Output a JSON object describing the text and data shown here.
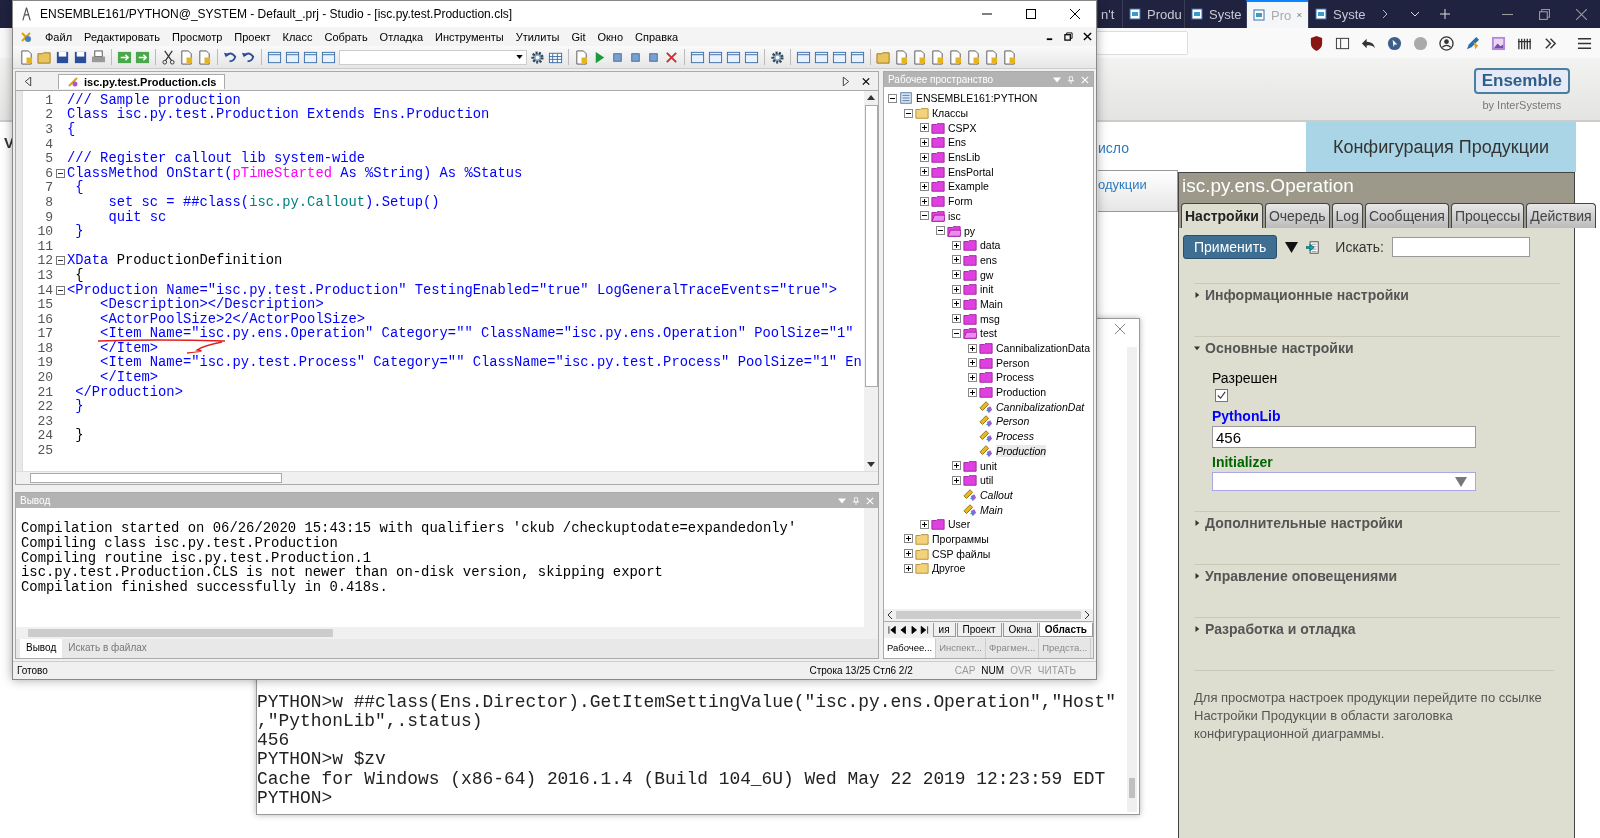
{
  "studio": {
    "title": "ENSEMBLE161/PYTHON@_SYSTEM - Default_.prj - Studio - [isc.py.test.Production.cls]",
    "menu": [
      "Файл",
      "Редактировать",
      "Просмотр",
      "Проект",
      "Класс",
      "Собрать",
      "Отладка",
      "Инструменты",
      "Утилиты",
      "Git",
      "Окно",
      "Справка"
    ],
    "editor_tab": "isc.py.test.Production.cls",
    "code": [
      {
        "number": "1",
        "fold": false,
        "tokens": [
          {
            "text": "/// Sample production",
            "kind": "kw"
          }
        ]
      },
      {
        "number": "2",
        "fold": false,
        "tokens": [
          {
            "text": "Class isc.py.test.Production Extends Ens.Production",
            "kind": "kw"
          }
        ]
      },
      {
        "number": "3",
        "fold": false,
        "tokens": [
          {
            "text": "{",
            "kind": "kw"
          }
        ]
      },
      {
        "number": "4",
        "fold": false
      },
      {
        "number": "5",
        "fold": false,
        "tokens": [
          {
            "text": "/// Register callout lib system-wide",
            "kind": "kw"
          }
        ]
      },
      {
        "number": "6",
        "fold": true,
        "tokens": [
          {
            "text": "ClassMethod OnStart(",
            "kind": "kw"
          },
          {
            "text": "pTimeStarted",
            "kind": "param"
          },
          {
            "text": " As %String) As %Status",
            "kind": "kw"
          }
        ]
      },
      {
        "number": "7",
        "fold": false,
        "tokens": [
          {
            "text": " {",
            "kind": "kw"
          }
        ]
      },
      {
        "number": "8",
        "fold": false,
        "tokens": [
          {
            "text": "     set sc = ##class(",
            "kind": "kw"
          },
          {
            "text": "isc.py.Callout",
            "kind": "cls"
          },
          {
            "text": ").Setup()",
            "kind": "kw"
          }
        ]
      },
      {
        "number": "9",
        "fold": false,
        "tokens": [
          {
            "text": "     quit sc",
            "kind": "kw"
          }
        ]
      },
      {
        "number": "10",
        "fold": false,
        "tokens": [
          {
            "text": " }",
            "kind": "kw"
          }
        ]
      },
      {
        "number": "11",
        "fold": false
      },
      {
        "number": "12",
        "fold": true,
        "tokens": [
          {
            "text": "XData",
            "kind": "kw"
          },
          {
            "text": " ProductionDefinition",
            "kind": "plain"
          }
        ]
      },
      {
        "number": "13",
        "fold": false,
        "tokens": [
          {
            "text": " {",
            "kind": "plain"
          }
        ]
      },
      {
        "number": "14",
        "fold": true,
        "tokens": [
          {
            "text": "<Production Name=\"isc.py.test.Production\" TestingEnabled=\"true\" LogGeneralTraceEvents=\"true\">",
            "kind": "kw"
          }
        ]
      },
      {
        "number": "15",
        "fold": false,
        "tokens": [
          {
            "text": "    <Description></Description>",
            "kind": "kw"
          }
        ]
      },
      {
        "number": "16",
        "fold": false,
        "tokens": [
          {
            "text": "    <ActorPoolSize>2</ActorPoolSize>",
            "kind": "kw"
          }
        ]
      },
      {
        "number": "17",
        "fold": false,
        "tokens": [
          {
            "text": "    <Item Name=\"isc.py.ens.Operation\" Category=\"\" ClassName=\"isc.py.ens.Operation\" PoolSize=\"1\"",
            "kind": "kw"
          }
        ]
      },
      {
        "number": "18",
        "fold": false,
        "tokens": [
          {
            "text": "    </Item>",
            "kind": "kw"
          }
        ]
      },
      {
        "number": "19",
        "fold": false,
        "tokens": [
          {
            "text": "    <Item Name=\"isc.py.test.Process\" Category=\"\" ClassName=\"isc.py.test.Process\" PoolSize=\"1\" En",
            "kind": "kw"
          }
        ]
      },
      {
        "number": "20",
        "fold": false,
        "tokens": [
          {
            "text": "    </Item>",
            "kind": "kw"
          }
        ]
      },
      {
        "number": "21",
        "fold": false,
        "tokens": [
          {
            "text": " </Production>",
            "kind": "kw"
          }
        ]
      },
      {
        "number": "22",
        "fold": false,
        "tokens": [
          {
            "text": " }",
            "kind": "kw"
          }
        ]
      },
      {
        "number": "23",
        "fold": false
      },
      {
        "number": "24",
        "fold": false,
        "tokens": [
          {
            "text": " }",
            "kind": "plain"
          }
        ]
      },
      {
        "number": "25",
        "fold": false
      }
    ],
    "output": {
      "title": "Вывод",
      "lines": [
        "Compilation started on 06/26/2020 15:43:15 with qualifiers 'ckub /checkuptodate=expandedonly'",
        "Compiling class isc.py.test.Production",
        "Compiling routine isc.py.test.Production.1",
        "isc.py.test.Production.CLS is not newer than on-disk version, skipping export",
        "Compilation finished successfully in 0.418s."
      ],
      "tabs": [
        {
          "label": "Вывод",
          "selected": true
        },
        {
          "label": "Искать в файлах",
          "selected": false
        }
      ]
    },
    "workspace": {
      "title": "Рабочее пространство",
      "tree": [
        {
          "label": "ENSEMBLE161:PYTHON",
          "kind": "root",
          "expanded": true,
          "selected": false,
          "children": [
            {
              "label": "Классы",
              "kind": "category",
              "expanded": true,
              "selected": false,
              "children": [
                {
                  "label": "CSPX",
                  "kind": "package",
                  "expanded": false,
                  "selected": false
                },
                {
                  "label": "Ens",
                  "kind": "package",
                  "expanded": false,
                  "selected": false
                },
                {
                  "label": "EnsLib",
                  "kind": "package",
                  "expanded": false,
                  "selected": false
                },
                {
                  "label": "EnsPortal",
                  "kind": "package",
                  "expanded": false,
                  "selected": false
                },
                {
                  "label": "Example",
                  "kind": "package",
                  "expanded": false,
                  "selected": false
                },
                {
                  "label": "Form",
                  "kind": "package",
                  "expanded": false,
                  "selected": false
                },
                {
                  "label": "isc",
                  "kind": "package",
                  "expanded": true,
                  "selected": false,
                  "children": [
                    {
                      "label": "py",
                      "kind": "package",
                      "expanded": true,
                      "selected": false,
                      "children": [
                        {
                          "label": "data",
                          "kind": "package",
                          "expanded": false,
                          "selected": false
                        },
                        {
                          "label": "ens",
                          "kind": "package",
                          "expanded": false,
                          "selected": false
                        },
                        {
                          "label": "gw",
                          "kind": "package",
                          "expanded": false,
                          "selected": false
                        },
                        {
                          "label": "init",
                          "kind": "package",
                          "expanded": false,
                          "selected": false
                        },
                        {
                          "label": "Main",
                          "kind": "package",
                          "expanded": false,
                          "selected": false
                        },
                        {
                          "label": "msg",
                          "kind": "package",
                          "expanded": false,
                          "selected": false
                        },
                        {
                          "label": "test",
                          "kind": "package",
                          "expanded": true,
                          "selected": false,
                          "children": [
                            {
                              "label": "CannibalizationData",
                              "kind": "package",
                              "expanded": false,
                              "selected": false
                            },
                            {
                              "label": "Person",
                              "kind": "package",
                              "expanded": false,
                              "selected": false
                            },
                            {
                              "label": "Process",
                              "kind": "package",
                              "expanded": false,
                              "selected": false
                            },
                            {
                              "label": "Production",
                              "kind": "package",
                              "expanded": false,
                              "selected": false
                            },
                            {
                              "label": "CannibalizationDat",
                              "kind": "class",
                              "selected": false
                            },
                            {
                              "label": "Person",
                              "kind": "class",
                              "selected": false
                            },
                            {
                              "label": "Process",
                              "kind": "class",
                              "selected": false
                            },
                            {
                              "label": "Production",
                              "kind": "class",
                              "selected": true
                            }
                          ]
                        },
                        {
                          "label": "unit",
                          "kind": "package",
                          "expanded": false,
                          "selected": false
                        },
                        {
                          "label": "util",
                          "kind": "package",
                          "expanded": false,
                          "selected": false
                        },
                        {
                          "label": "Callout",
                          "kind": "class",
                          "selected": false
                        },
                        {
                          "label": "Main",
                          "kind": "class",
                          "selected": false
                        }
                      ]
                    }
                  ]
                },
                {
                  "label": "User",
                  "kind": "package",
                  "expanded": false,
                  "selected": false
                }
              ]
            },
            {
              "label": "Программы",
              "kind": "category",
              "expanded": false,
              "selected": false
            },
            {
              "label": "CSP файлы",
              "kind": "category",
              "expanded": false,
              "selected": false
            },
            {
              "label": "Другое",
              "kind": "category",
              "expanded": false,
              "selected": false
            }
          ]
        }
      ],
      "view_tabs": [
        {
          "label": "ия",
          "selected": false
        },
        {
          "label": "Проект",
          "selected": false
        },
        {
          "label": "Окна",
          "selected": false
        },
        {
          "label": "Область",
          "selected": true
        }
      ],
      "panel_tabs": [
        {
          "label": "Рабочее...",
          "selected": true
        },
        {
          "label": "Инспект...",
          "selected": false
        },
        {
          "label": "Фрагмен...",
          "selected": false
        },
        {
          "label": "Предста...",
          "selected": false
        }
      ]
    },
    "status_bar": {
      "message": "Готово",
      "position": "Строка 13/25 Стл6 2/2",
      "indicators": [
        {
          "label": "CAP",
          "on": false
        },
        {
          "label": "NUM",
          "on": true
        },
        {
          "label": "OVR",
          "on": false
        },
        {
          "label": "ЧИТАТЬ",
          "on": false
        }
      ]
    }
  },
  "browser": {
    "tabs": [
      {
        "label": "n't",
        "selected": false
      },
      {
        "label": "Produ",
        "selected": false
      },
      {
        "label": "Syste",
        "selected": false
      },
      {
        "label": "Pro",
        "selected": true
      },
      {
        "label": "Syste",
        "selected": false
      }
    ],
    "logo": {
      "name": "Ensemble",
      "byline": "by InterSystems"
    },
    "left_letter": "V",
    "page_links": [
      "исло",
      "одукции"
    ],
    "header": "Конфигурация Продукции",
    "panel": {
      "title": "isc.py.ens.Operation",
      "tabs": [
        {
          "label": "Настройки",
          "selected": true
        },
        {
          "label": "Очередь",
          "selected": false
        },
        {
          "label": "Log",
          "selected": false
        },
        {
          "label": "Сообщения",
          "selected": false
        },
        {
          "label": "Процессы",
          "selected": false
        },
        {
          "label": "Действия",
          "selected": false
        }
      ],
      "apply_button": "Применить",
      "search_label": "Искать:",
      "sections": [
        {
          "title": "Информационные настройки",
          "expanded": false
        },
        {
          "title": "Основные настройки",
          "expanded": true,
          "settings": [
            {
              "kind": "checkbox",
              "label": "Разрешен",
              "color": "#000000",
              "checked": true
            },
            {
              "kind": "text",
              "label": "PythonLib",
              "color": "#0000ff",
              "value": "456"
            },
            {
              "kind": "select",
              "label": "Initializer",
              "color": "#006600"
            }
          ]
        },
        {
          "title": "Дополнительные настройки",
          "expanded": false
        },
        {
          "title": "Управление оповещениями",
          "expanded": false
        },
        {
          "title": "Разработка и отладка",
          "expanded": false
        }
      ],
      "help_text": "Для просмотра настроек продукции перейдите по ссылке Настройки Продукции в области заголовка конфигурационной диаграммы."
    }
  },
  "terminal": {
    "lines": [
      "PYTHON>w ##class(Ens.Director).GetItemSettingValue(\"isc.py.ens.Operation\",\"Host\"",
      ",\"PythonLib\",.status)",
      "456",
      "PYTHON>w $zv",
      "Cache for Windows (x86-64) 2016.1.4 (Build 104_6U) Wed May 22 2019 12:23:59 EDT",
      "PYTHON>"
    ]
  }
}
